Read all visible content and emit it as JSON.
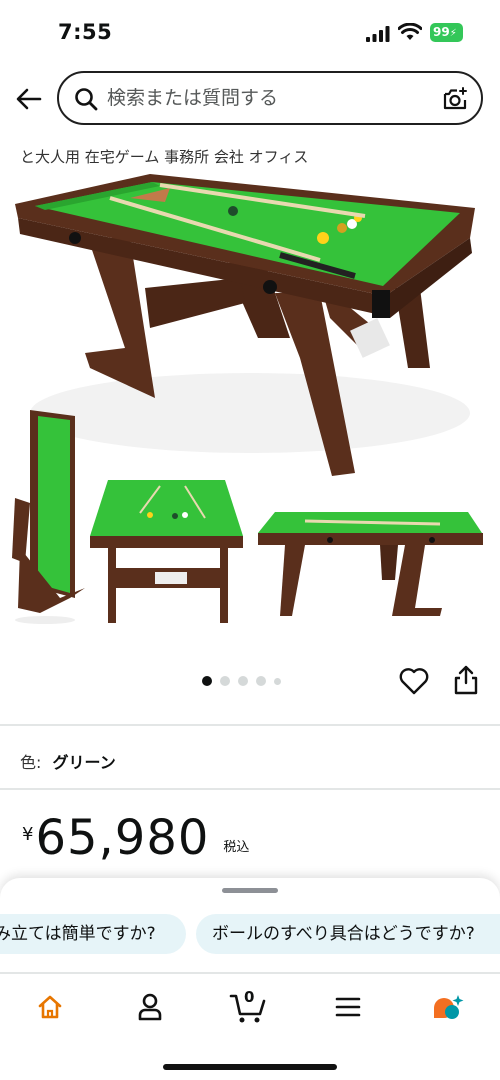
{
  "status": {
    "time": "7:55",
    "battery": "99"
  },
  "search": {
    "placeholder": "検索または質問する"
  },
  "product": {
    "title_line": "と大人用 在宅ゲーム 事務所 会社 オフィス",
    "color_label": "色:",
    "color_value": "グリーン",
    "currency": "¥",
    "price": "65,980",
    "tax_note": "税込"
  },
  "gallery": {
    "image_count": 5,
    "active_index": 0
  },
  "questions": [
    "み立ては簡単ですか?",
    "ボールのすべり具合はどうですか?"
  ],
  "tabbar": {
    "items": [
      "home-icon",
      "account-icon",
      "cart-icon",
      "menu-icon",
      "rufus-icon"
    ],
    "cart_count": "0",
    "accent": "#e77600"
  },
  "colors": {
    "felt": "#35c23a",
    "wood": "#5a2f1c",
    "chip_bg": "#e6f4f8"
  }
}
